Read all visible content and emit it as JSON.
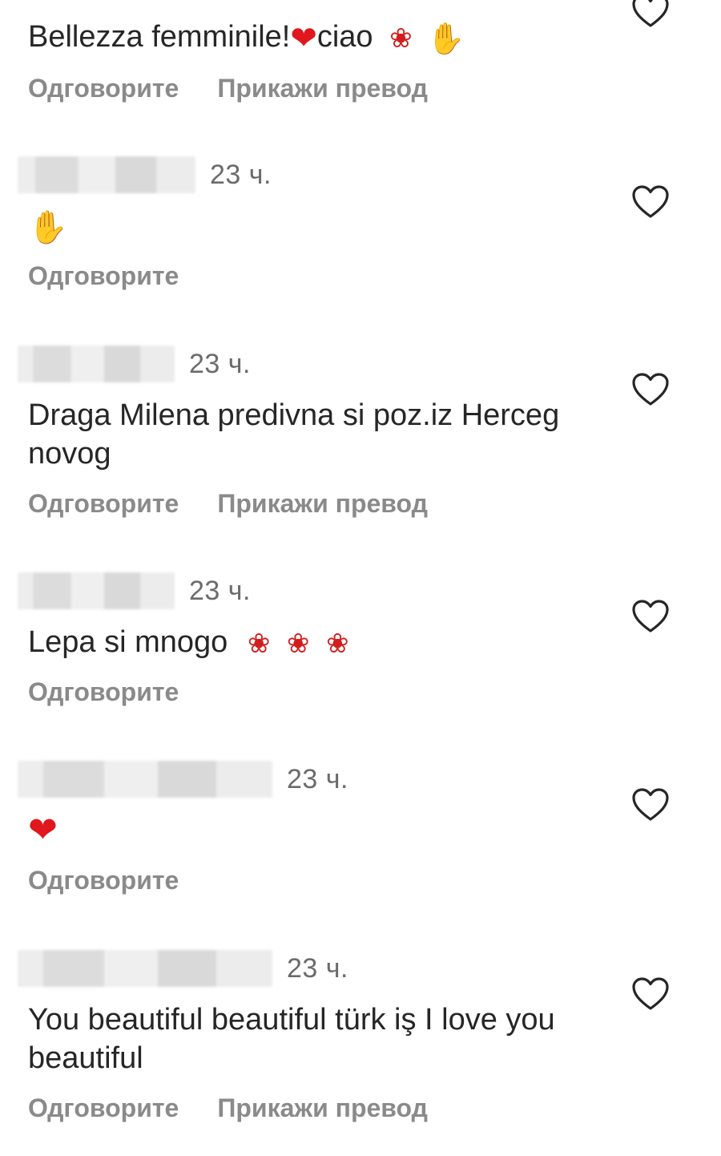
{
  "actions": {
    "reply": "Одговорите",
    "translate": "Прикажи превод"
  },
  "icons": {
    "like": "heart-outline-icon",
    "rose": "rose-emoji",
    "raised_hand": "raised-hand-emoji",
    "clapping": "clapping-hands-emoji",
    "red_heart": "red-heart-emoji"
  },
  "colors": {
    "text": "#262626",
    "muted": "#8a8a8a",
    "heart": "#e0171d"
  },
  "comments": [
    {
      "text_before": "Bellezza  femminile!",
      "text_after": "ciao"
    },
    {
      "time": "23 ч."
    },
    {
      "time": "23 ч.",
      "text": "Draga Milena predivna si poz.iz Herceg novog"
    },
    {
      "time": "23 ч.",
      "text": "Lepa si mnogo"
    },
    {
      "time": "23 ч."
    },
    {
      "time": "23 ч.",
      "text": "You beautiful beautiful türk iş I love you beautiful"
    }
  ]
}
